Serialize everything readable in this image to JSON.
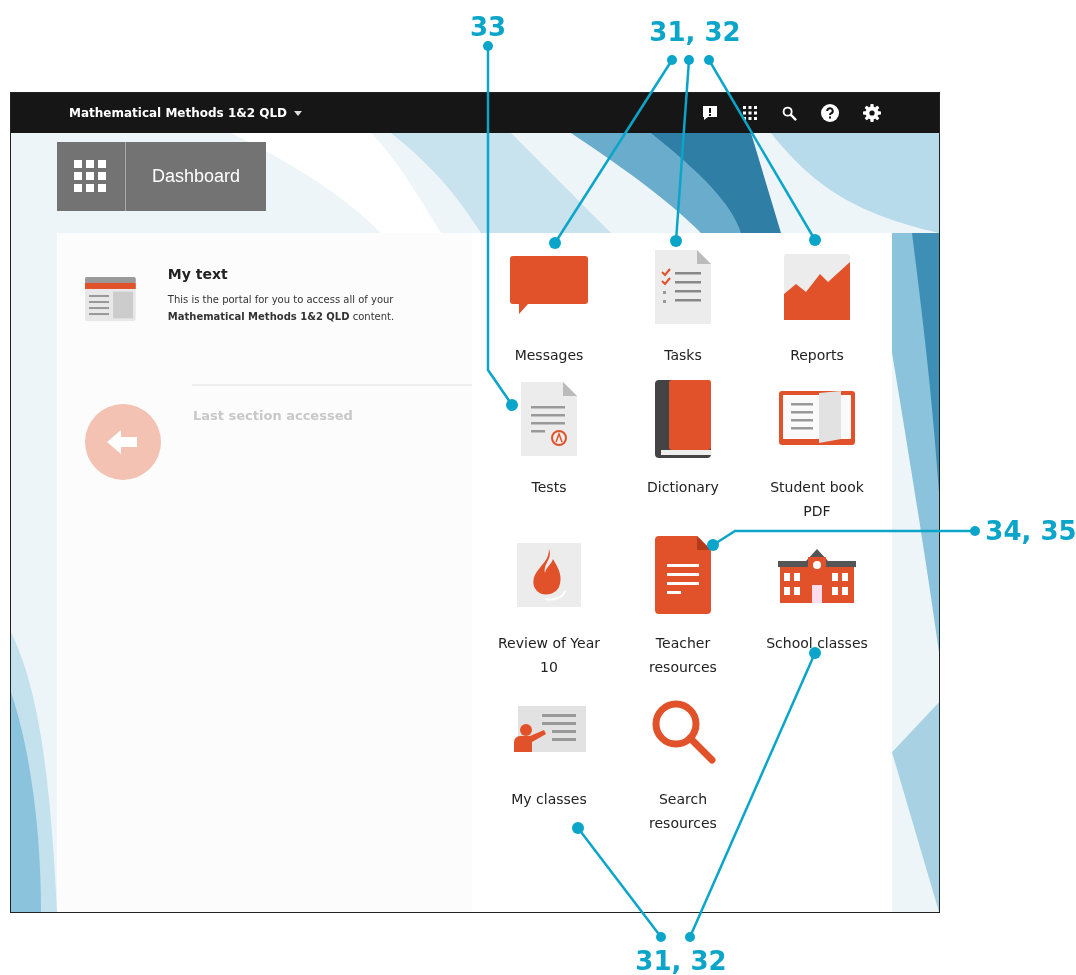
{
  "topbar": {
    "course": "Mathematical Methods 1&2 QLD"
  },
  "dashboard_button": {
    "label": "Dashboard"
  },
  "my_text": {
    "title": "My text",
    "description": "This is the portal for you to access all of your **Mathematical Methods 1&2 QLD** content."
  },
  "last_section": {
    "label": "Last section accessed",
    "disabled": true
  },
  "tiles": [
    {
      "label": "Messages",
      "kind": "message"
    },
    {
      "label": "Tasks",
      "kind": "tasks"
    },
    {
      "label": "Reports",
      "kind": "reports"
    },
    {
      "label": "Tests",
      "kind": "tests"
    },
    {
      "label": "Dictionary",
      "kind": "dictionary"
    },
    {
      "label": "Student book PDF",
      "kind": "book"
    },
    {
      "label": "Review of Year 10",
      "kind": "flame"
    },
    {
      "label": "Teacher resources",
      "kind": "document"
    },
    {
      "label": "School classes",
      "kind": "school"
    },
    {
      "label": "My classes",
      "kind": "classes"
    },
    {
      "label": "Search resources",
      "kind": "search"
    }
  ],
  "callouts": [
    {
      "text": "33"
    },
    {
      "text": "31, 32"
    },
    {
      "text": "34, 35"
    },
    {
      "text": "31, 32"
    }
  ]
}
